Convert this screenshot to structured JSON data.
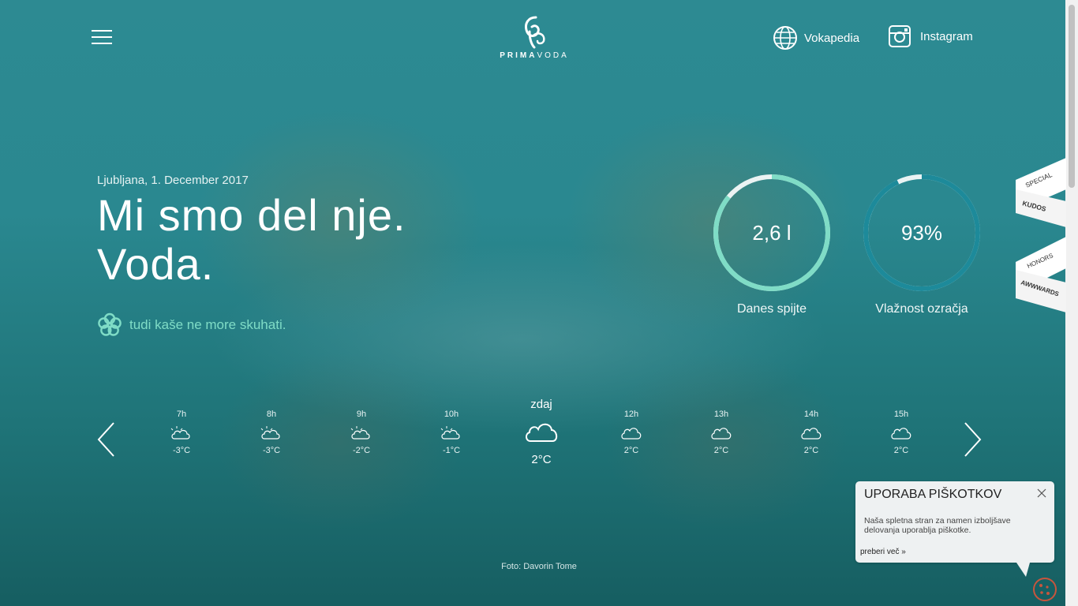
{
  "header": {
    "logo_text_bold": "PRIMA",
    "logo_text_light": "VODA",
    "links": [
      {
        "label": "Vokapedia",
        "icon": "globe-icon"
      },
      {
        "label": "Instagram",
        "icon": "instagram-icon"
      }
    ]
  },
  "hero": {
    "date": "Ljubljana, 1. December 2017",
    "headline_line1": "Mi smo del nje.",
    "headline_line2": "Voda.",
    "tagline": "tudi kaše ne more skuhati.",
    "tagline_icon": "flower-icon"
  },
  "gauges": [
    {
      "value": "2,6 l",
      "caption": "Danes spijte",
      "fill": 0.86,
      "color": "#7fdcc6"
    },
    {
      "value": "93%",
      "caption": "Vlažnost ozračja",
      "fill": 0.93,
      "color": "#1d8a9a"
    }
  ],
  "badges": [
    "SPECIAL KUDOS",
    "HONORS AWWWARDS"
  ],
  "forecast": {
    "hours": [
      {
        "time": "7h",
        "temp": "-3°C",
        "icon": "partly-cloudy-icon"
      },
      {
        "time": "8h",
        "temp": "-3°C",
        "icon": "partly-cloudy-icon"
      },
      {
        "time": "9h",
        "temp": "-2°C",
        "icon": "partly-cloudy-icon"
      },
      {
        "time": "10h",
        "temp": "-1°C",
        "icon": "partly-cloudy-icon"
      },
      {
        "time": "12h",
        "temp": "2°C",
        "icon": "cloud-icon"
      },
      {
        "time": "13h",
        "temp": "2°C",
        "icon": "cloud-icon"
      },
      {
        "time": "14h",
        "temp": "2°C",
        "icon": "cloud-icon"
      },
      {
        "time": "15h",
        "temp": "2°C",
        "icon": "cloud-icon"
      }
    ],
    "now": {
      "time": "zdaj",
      "temp": "2°C",
      "icon": "cloud-icon"
    }
  },
  "credit": "Foto: Davorin Tome",
  "cookie_notice": {
    "title": "UPORABA PIŠKOTKOV",
    "text": "Naša spletna stran za namen izboljšave delovanja uporablja piškotke.",
    "more": "preberi več »"
  },
  "colors": {
    "accent": "#7fdcc6",
    "background": "#2a8890"
  }
}
